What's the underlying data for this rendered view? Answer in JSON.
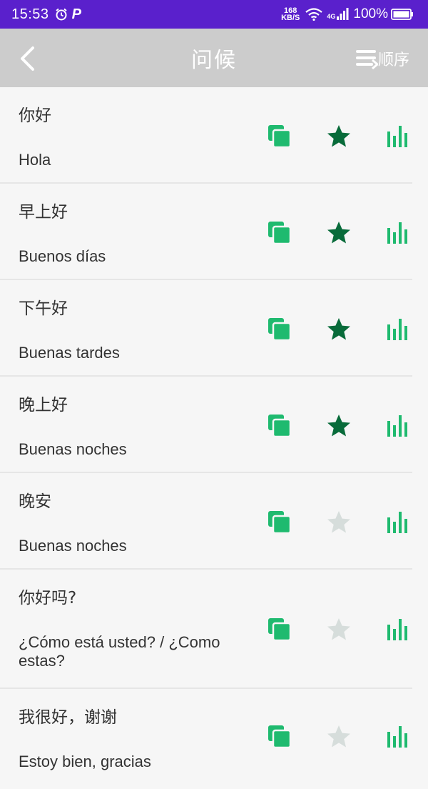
{
  "status_bar": {
    "time": "15:53",
    "p_glyph": "P",
    "speed_value": "168",
    "speed_unit": "KB/S",
    "network": "4G",
    "battery_percent": "100%"
  },
  "app_bar": {
    "title": "问候",
    "sort_label": "顺序",
    "back_icon": "chevron-left-icon",
    "sort_icon": "sort-lines-icon"
  },
  "colors": {
    "status_bar": "#5a20cc",
    "app_bar": "#cccccc",
    "copy_icon": "#1fba6f",
    "star_active": "#086b3a",
    "star_inactive": "#d6dddb",
    "stats_icon": "#1fba6f",
    "text": "#333333"
  },
  "phrases": [
    {
      "zh": "你好",
      "es": "Hola",
      "favorite": true
    },
    {
      "zh": "早上好",
      "es": "Buenos días",
      "favorite": true
    },
    {
      "zh": "下午好",
      "es": "Buenas tardes",
      "favorite": true
    },
    {
      "zh": "晚上好",
      "es": "Buenas noches",
      "favorite": true
    },
    {
      "zh": "晚安",
      "es": "Buenas noches",
      "favorite": false
    },
    {
      "zh": "你好吗?",
      "es": "¿Cómo está usted? / ¿Como estas?",
      "favorite": false
    },
    {
      "zh": "我很好，谢谢",
      "es": "Estoy bien, gracias",
      "favorite": false
    }
  ]
}
